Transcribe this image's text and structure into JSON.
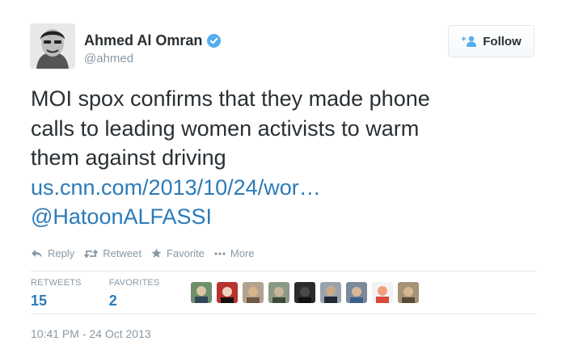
{
  "author": {
    "name": "Ahmed Al Omran",
    "handle": "@ahmed",
    "verified": true
  },
  "follow_button": {
    "label": "Follow",
    "icon": "add-user-icon"
  },
  "tweet": {
    "lines": [
      "MOI spox confirms that they made phone",
      "calls to leading women activists to warm",
      "them against driving"
    ],
    "link": "us.cnn.com/2013/10/24/wor…",
    "mention": "@HatoonALFASSI"
  },
  "actions": [
    {
      "label": "Reply",
      "icon": "reply-icon"
    },
    {
      "label": "Retweet",
      "icon": "retweet-icon"
    },
    {
      "label": "Favorite",
      "icon": "star-icon"
    },
    {
      "label": "More",
      "icon": "more-dots-icon"
    }
  ],
  "stats": {
    "retweets_label": "RETWEETS",
    "retweets_count": "15",
    "favorites_label": "FAVORITES",
    "favorites_count": "2"
  },
  "timestamp": "10:41 PM - 24 Oct 2013",
  "colors": {
    "link": "#2b7bb9",
    "muted": "#8899a6",
    "verified": "#55acee",
    "text": "#292f33"
  }
}
